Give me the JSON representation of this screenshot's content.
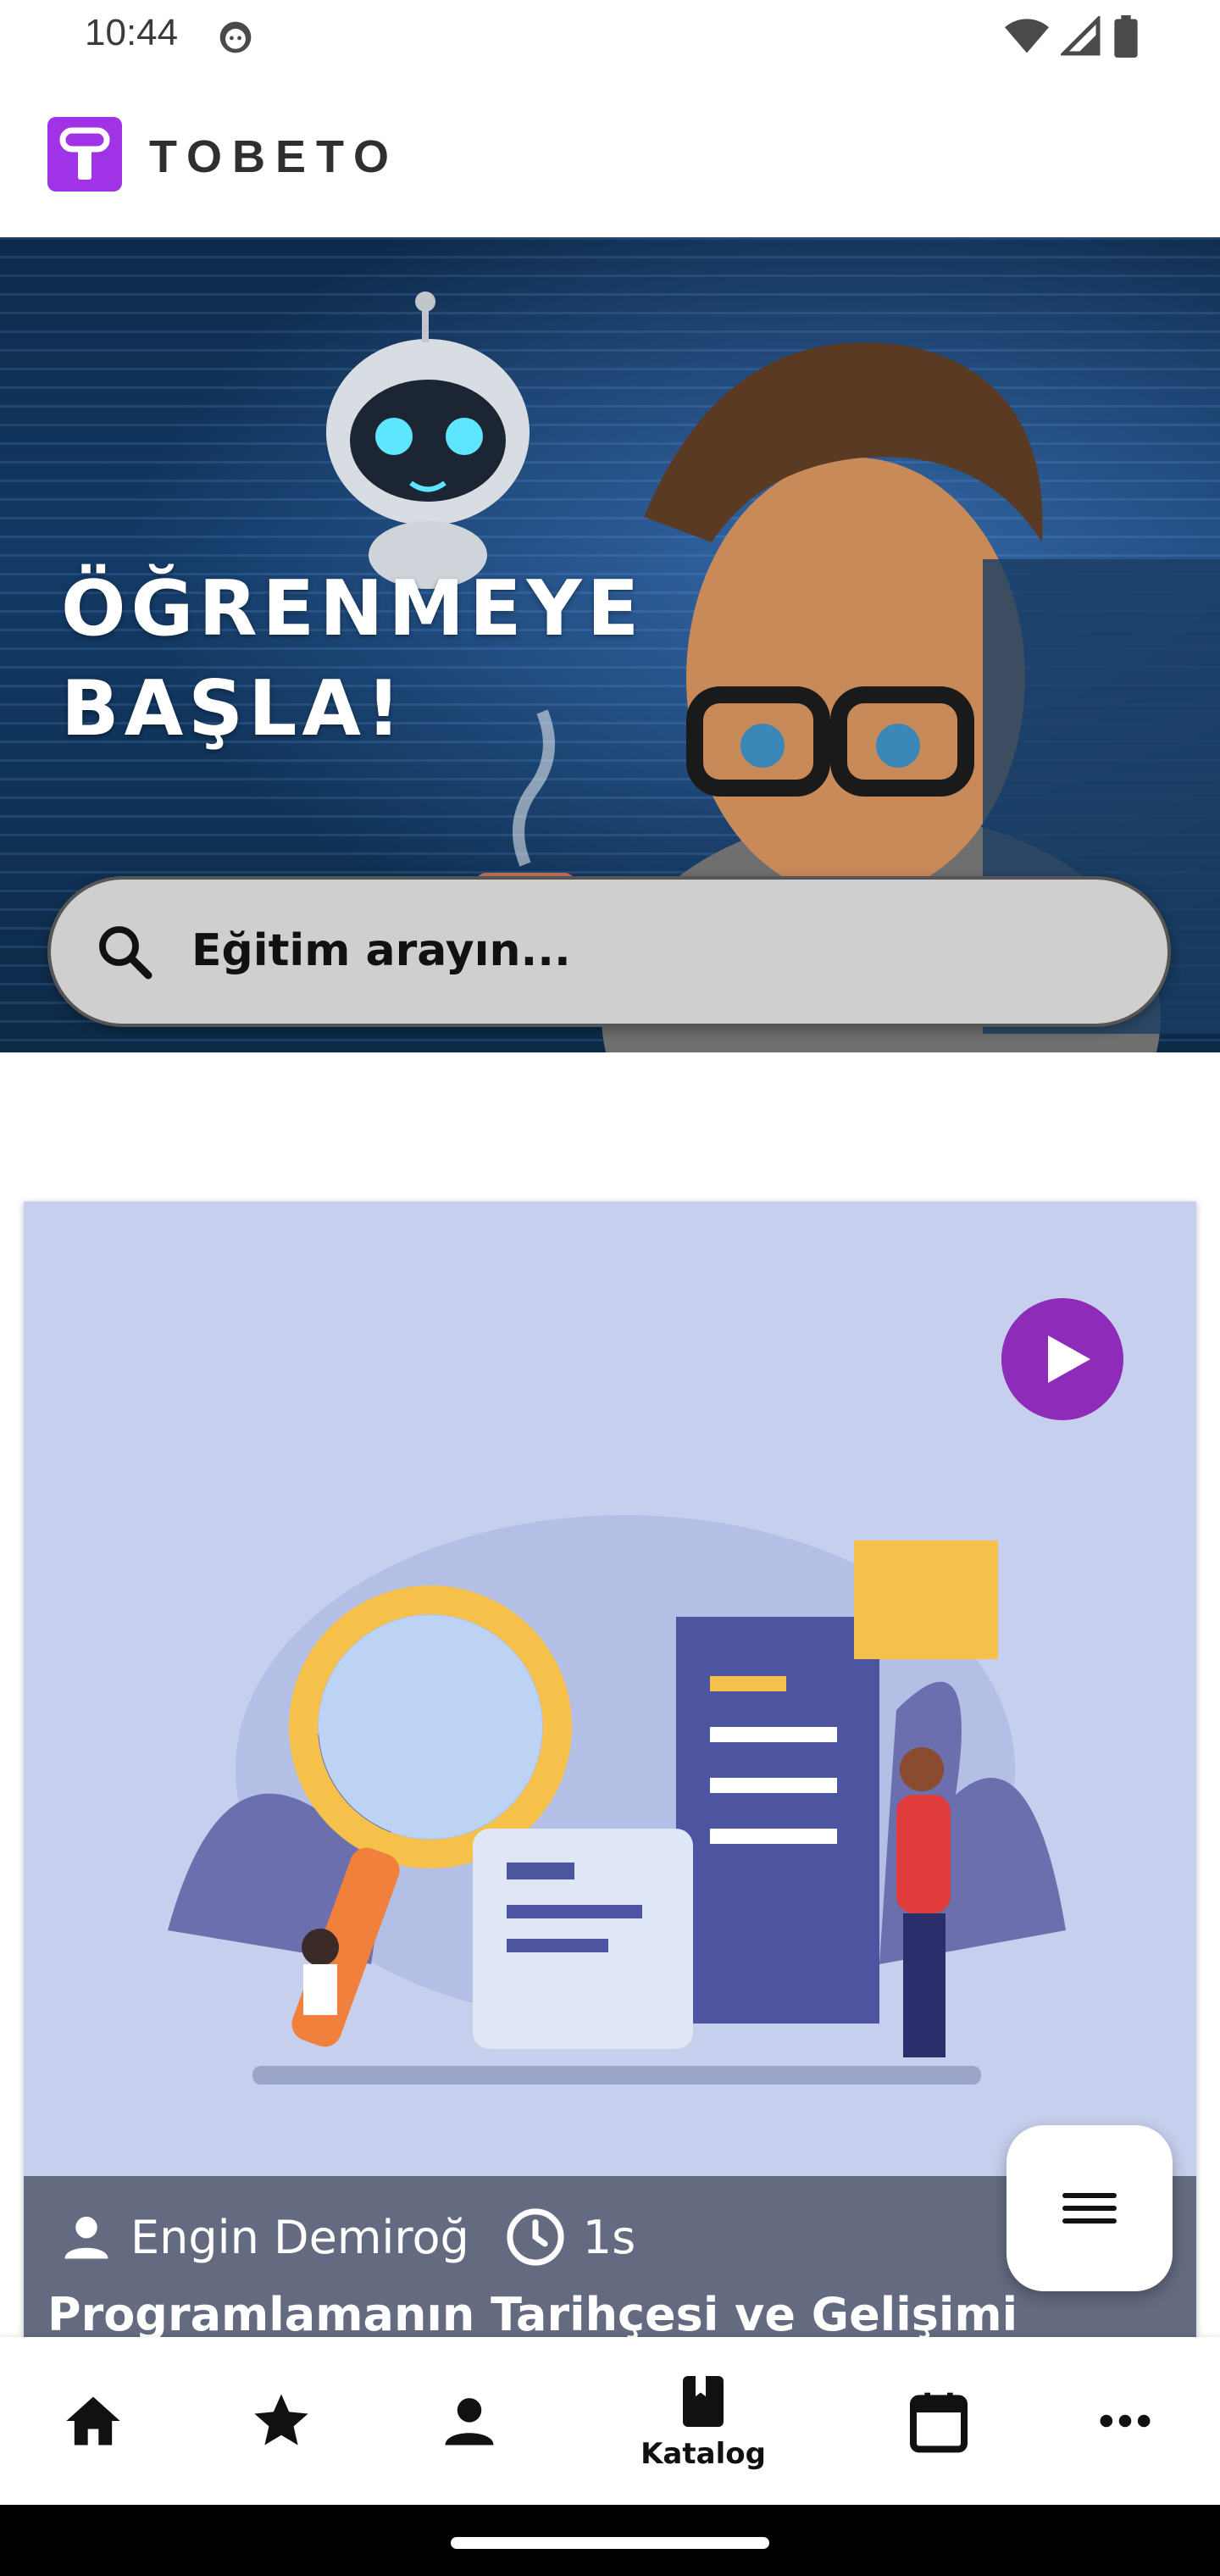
{
  "status_bar": {
    "time": "10:44"
  },
  "header": {
    "logo_text": "TOBETO",
    "brand_color": "#a033e6"
  },
  "hero": {
    "title": "ÖĞRENMEYE\nBAŞLA!",
    "search_placeholder": "Eğitim arayın..."
  },
  "course_card": {
    "instructor": "Engin Demiroğ",
    "duration": "1s",
    "title": "Programlamanın Tarihçesi ve Gelişimi",
    "play_color": "#8e2bb9"
  },
  "bottom_nav": {
    "items": [
      {
        "icon": "home-icon",
        "label": ""
      },
      {
        "icon": "star-icon",
        "label": ""
      },
      {
        "icon": "person-icon",
        "label": ""
      },
      {
        "icon": "book-icon",
        "label": "Katalog"
      },
      {
        "icon": "calendar-icon",
        "label": ""
      },
      {
        "icon": "more-icon",
        "label": ""
      }
    ]
  }
}
